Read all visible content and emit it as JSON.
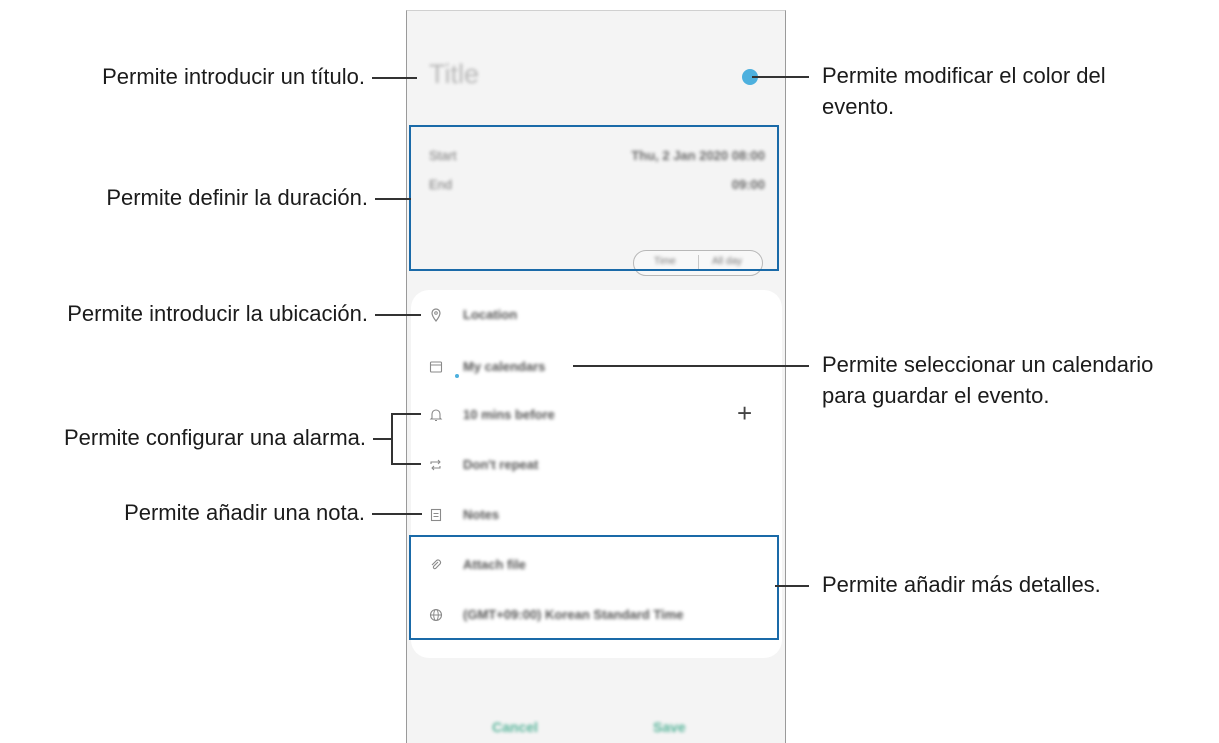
{
  "callouts": {
    "title": "Permite introducir un título.",
    "duration": "Permite definir la duración.",
    "location": "Permite introducir la ubicación.",
    "alarm": "Permite configurar una alarma.",
    "note": "Permite añadir una nota.",
    "color_line1": "Permite modificar el color del",
    "color_line2": "evento.",
    "calendar_line1": "Permite seleccionar un calendario",
    "calendar_line2": "para guardar el evento.",
    "details": "Permite añadir más detalles."
  },
  "screen": {
    "title_placeholder": "Title",
    "start_label": "Start",
    "start_value": "Thu, 2 Jan 2020  08:00",
    "end_label": "End",
    "end_value": "09:00",
    "toggle_time": "Time",
    "toggle_allday": "All day",
    "location": "Location",
    "calendar": "My calendars",
    "alarm": "10 mins before",
    "repeat": "Don't repeat",
    "notes": "Notes",
    "attach": "Attach file",
    "timezone": "(GMT+09:00) Korean Standard Time",
    "cancel": "Cancel",
    "save": "Save"
  },
  "icons": {
    "location": "location-pin-icon",
    "calendar": "calendar-icon",
    "alarm": "bell-icon",
    "repeat": "repeat-icon",
    "notes": "note-icon",
    "attach": "paperclip-icon",
    "timezone": "globe-icon",
    "add": "plus-icon"
  },
  "colors": {
    "event_color": "#4db0de",
    "highlight": "#1a6aa8",
    "button_text": "#58b49a"
  }
}
